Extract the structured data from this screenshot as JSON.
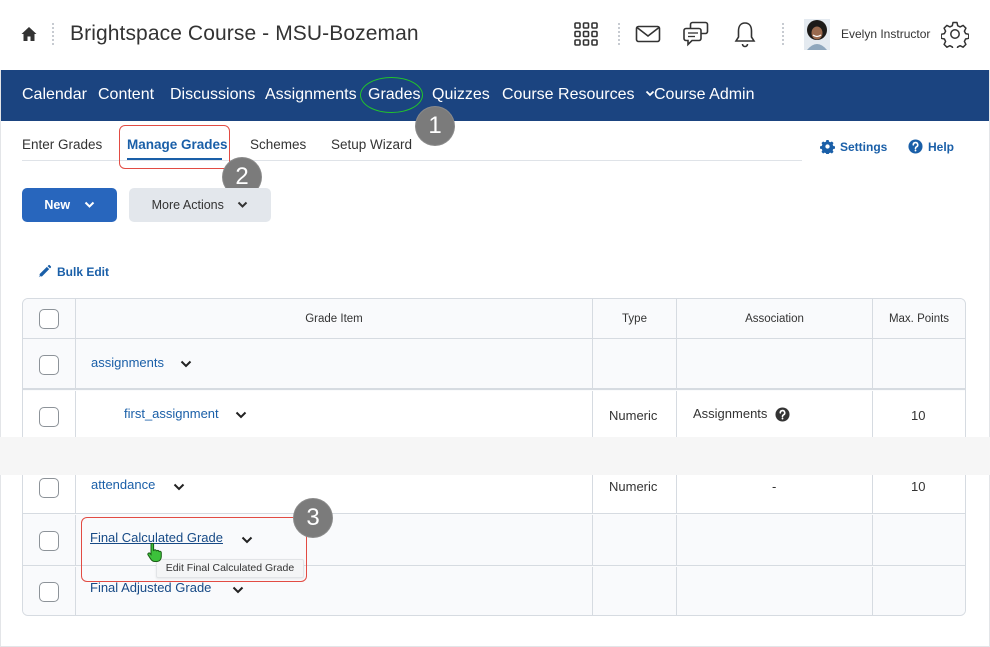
{
  "header": {
    "course_title": "Brightspace Course - MSU-Bozeman",
    "user_name": "Evelyn Instructor",
    "icons": [
      "home-icon",
      "app-grid-icon",
      "mail-icon",
      "chat-icon",
      "bell-icon",
      "avatar",
      "gear-icon"
    ]
  },
  "navbar": {
    "items": [
      {
        "label": "Calendar"
      },
      {
        "label": "Content"
      },
      {
        "label": "Discussions"
      },
      {
        "label": "Assignments"
      },
      {
        "label": "Grades"
      },
      {
        "label": "Quizzes"
      },
      {
        "label": "Course Resources",
        "has_dropdown": true
      },
      {
        "label": "Course Admin"
      }
    ],
    "highlighted": "Grades"
  },
  "subtabs": {
    "items": [
      {
        "label": "Enter Grades"
      },
      {
        "label": "Manage Grades",
        "active": true
      },
      {
        "label": "Schemes"
      },
      {
        "label": "Setup Wizard"
      }
    ],
    "settings_label": "Settings",
    "help_label": "Help"
  },
  "toolbar": {
    "new_label": "New",
    "more_actions_label": "More Actions",
    "bulk_edit_label": "Bulk Edit"
  },
  "callouts": [
    "1",
    "2",
    "3"
  ],
  "table": {
    "columns": [
      "Grade Item",
      "Type",
      "Association",
      "Max. Points"
    ],
    "rows": [
      {
        "name": "assignments",
        "type": "",
        "association": "",
        "max_points": "",
        "category": true
      },
      {
        "name": "first_assignment",
        "type": "Numeric",
        "association": "Assignments",
        "max_points": "10",
        "indented": true,
        "help_icon": true
      },
      {
        "name": "attendance",
        "type": "Numeric",
        "association": "-",
        "max_points": "10"
      },
      {
        "name": "Final Calculated Grade",
        "type": "",
        "association": "",
        "max_points": ""
      },
      {
        "name": "Final Adjusted Grade",
        "type": "",
        "association": "",
        "max_points": ""
      }
    ]
  },
  "tooltip": "Edit Final Calculated Grade",
  "colors": {
    "navbar": "#1b4480",
    "link": "#1a5fa8",
    "primary_button": "#2866bd",
    "callout_badge": "#7b7b7b",
    "highlight_red": "#e24b43",
    "highlight_green": "#22c42b"
  }
}
